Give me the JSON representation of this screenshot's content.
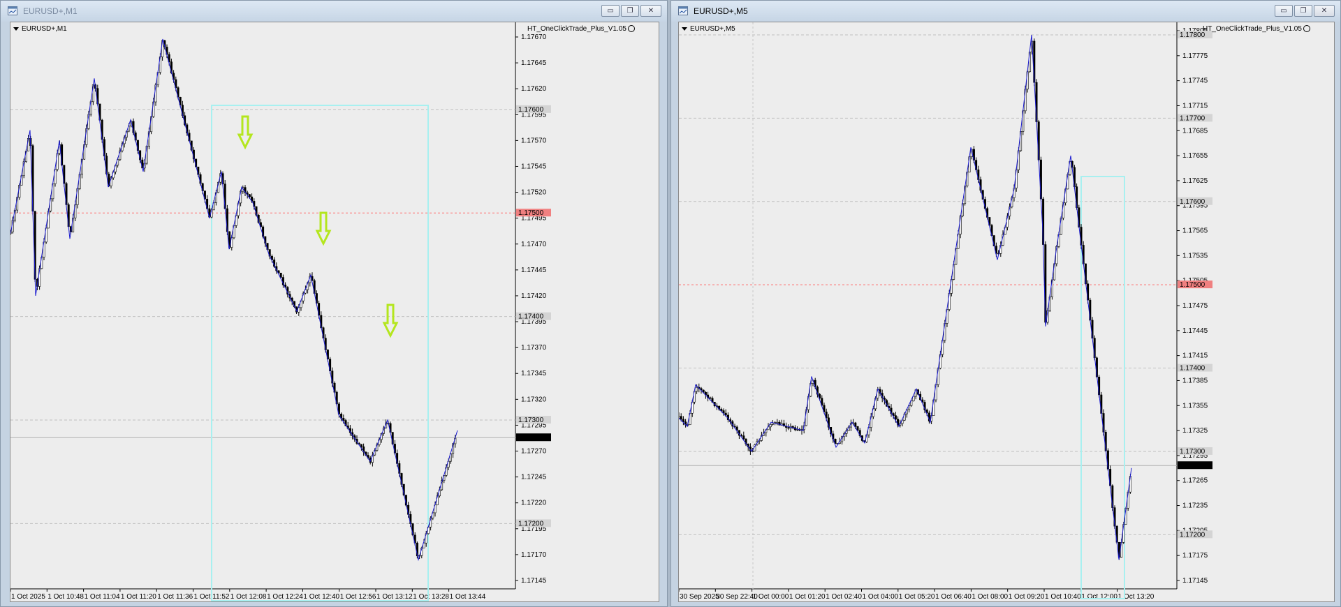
{
  "windows": [
    {
      "title": "EURUSD+,M1",
      "symbol_label": "EURUSD+,M1",
      "ea_label": "HT_OneClickTrade_Plus_V1.05",
      "active": false,
      "price_labels": [
        "1.17670",
        "1.17645",
        "1.17620",
        "1.17595",
        "1.17570",
        "1.17545",
        "1.17520",
        "1.17495",
        "1.17470",
        "1.17445",
        "1.17420",
        "1.17395",
        "1.17370",
        "1.17345",
        "1.17320",
        "1.17295",
        "1.17270",
        "1.17245",
        "1.17220",
        "1.17195",
        "1.17170",
        "1.17145"
      ],
      "time_labels": [
        "1 Oct 2025",
        "1 Oct 10:48",
        "1 Oct 11:04",
        "1 Oct 11:20",
        "1 Oct 11:36",
        "1 Oct 11:52",
        "1 Oct 12:08",
        "1 Oct 12:24",
        "1 Oct 12:40",
        "1 Oct 12:56",
        "1 Oct 13:12",
        "1 Oct 13:28",
        "1 Oct 13:44"
      ],
      "current_price": "1.17283",
      "level_red": "1.17500",
      "grey_levels": [
        "1.17600",
        "1.17400",
        "1.17300",
        "1.17200"
      ]
    },
    {
      "title": "EURUSD+,M5",
      "symbol_label": "EURUSD+,M5",
      "ea_label": "HT_OneClickTrade_Plus_V1.05",
      "active": true,
      "price_labels": [
        "1.17805",
        "1.17775",
        "1.17745",
        "1.17715",
        "1.17685",
        "1.17655",
        "1.17625",
        "1.17595",
        "1.17565",
        "1.17535",
        "1.17505",
        "1.17475",
        "1.17445",
        "1.17415",
        "1.17385",
        "1.17355",
        "1.17325",
        "1.17295",
        "1.17265",
        "1.17235",
        "1.17205",
        "1.17175",
        "1.17145"
      ],
      "time_labels": [
        "30 Sep 2025",
        "30 Sep 22:40",
        "1 Oct 00:00",
        "1 Oct 01:20",
        "1 Oct 02:40",
        "1 Oct 04:00",
        "1 Oct 05:20",
        "1 Oct 06:40",
        "1 Oct 08:00",
        "1 Oct 09:20",
        "1 Oct 10:40",
        "1 Oct 12:00",
        "1 Oct 13:20"
      ],
      "current_price": "1.17283",
      "level_red": "1.17500",
      "grey_levels": [
        "1.17800",
        "1.17700",
        "1.17600",
        "1.17400",
        "1.17300",
        "1.17200"
      ]
    }
  ],
  "icons": {
    "minimize": "minimize-icon",
    "restore": "restore-icon",
    "close": "close-icon",
    "arrow": "down-arrow-icon",
    "app": "chart-window-icon"
  },
  "colors": {
    "zigzag": "#1a1ad0",
    "box": "#a8f0f0",
    "arrow": "#b4e61e",
    "red_level": "#ff6e6e",
    "grey_level": "#c0c0c0",
    "current_price_bg": "#000000"
  }
}
